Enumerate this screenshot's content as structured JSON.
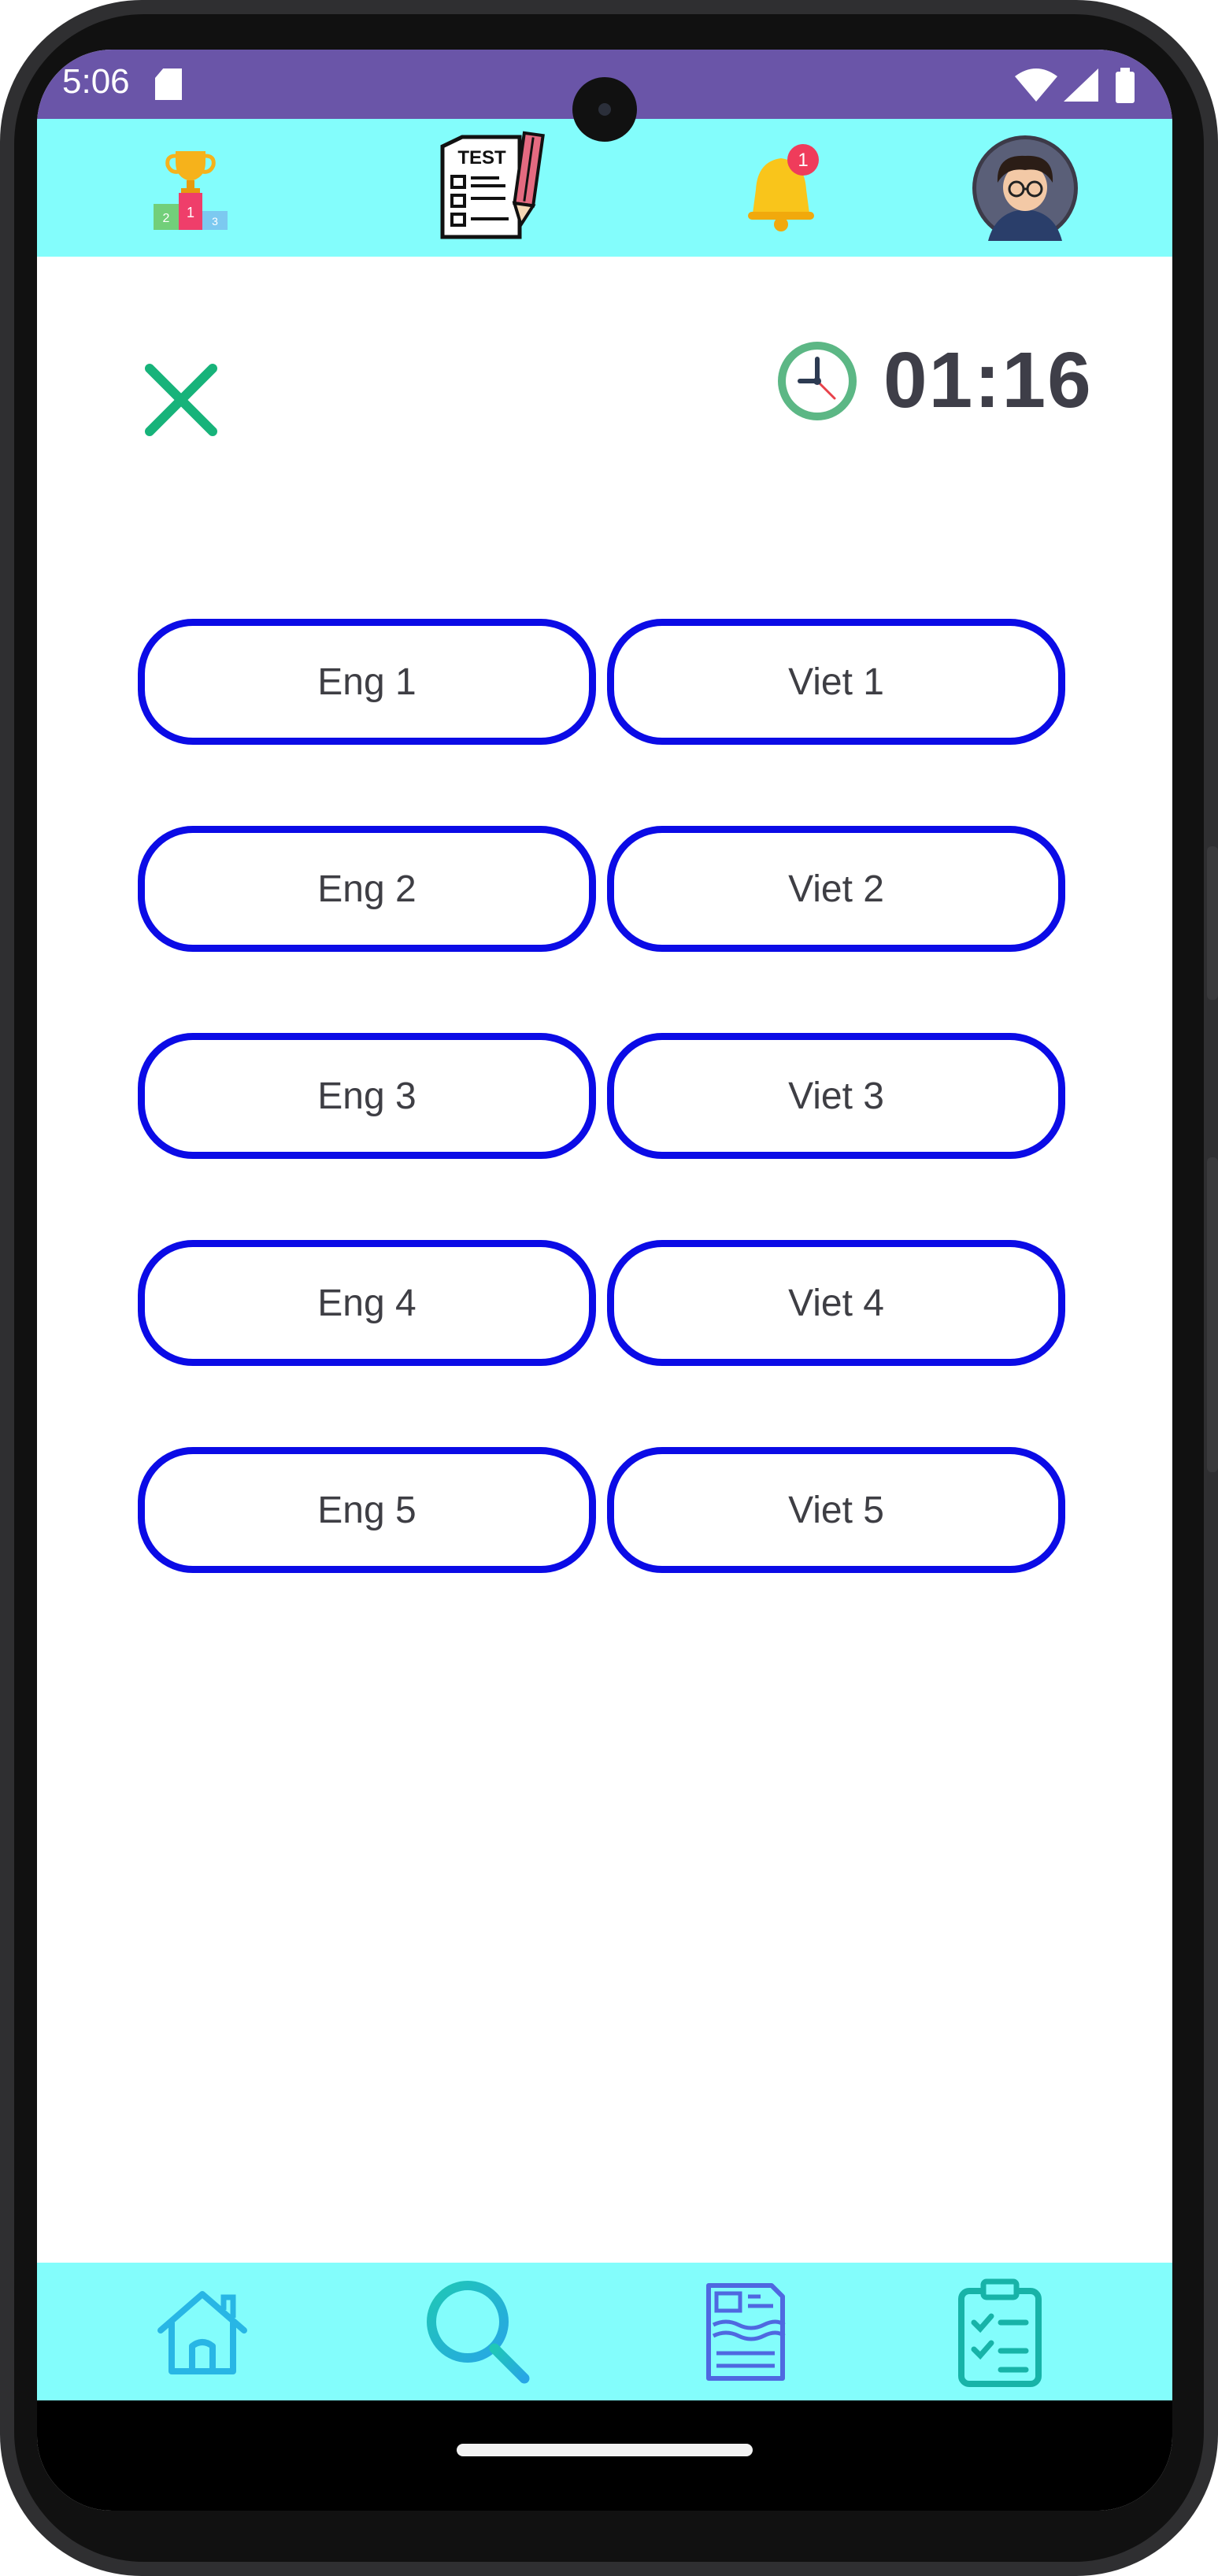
{
  "status_bar": {
    "time": "5:06",
    "icons": [
      "sd-card-icon",
      "wifi-icon",
      "signal-icon",
      "battery-icon"
    ],
    "background": "#6a55a8"
  },
  "top_bar": {
    "background": "#83fdfc",
    "icons": [
      "leaderboard-trophy-icon",
      "test-document-icon",
      "notification-bell-icon",
      "avatar"
    ],
    "test_icon_label": "TEST",
    "podium_labels": [
      "2",
      "1",
      "3"
    ],
    "notification_count": "1"
  },
  "quiz": {
    "close_icon": "close-icon",
    "timer_icon": "clock-icon",
    "timer": "01:16",
    "pairs": [
      {
        "left": "Eng 1",
        "right": "Viet 1"
      },
      {
        "left": "Eng 2",
        "right": "Viet 2"
      },
      {
        "left": "Eng 3",
        "right": "Viet 3"
      },
      {
        "left": "Eng 4",
        "right": "Viet 4"
      },
      {
        "left": "Eng 5",
        "right": "Viet 5"
      }
    ],
    "button_border_color": "#0b0be6"
  },
  "bottom_nav": {
    "background": "#83fdfc",
    "items": [
      "home-icon",
      "search-icon",
      "news-icon",
      "checklist-clipboard-icon"
    ]
  }
}
